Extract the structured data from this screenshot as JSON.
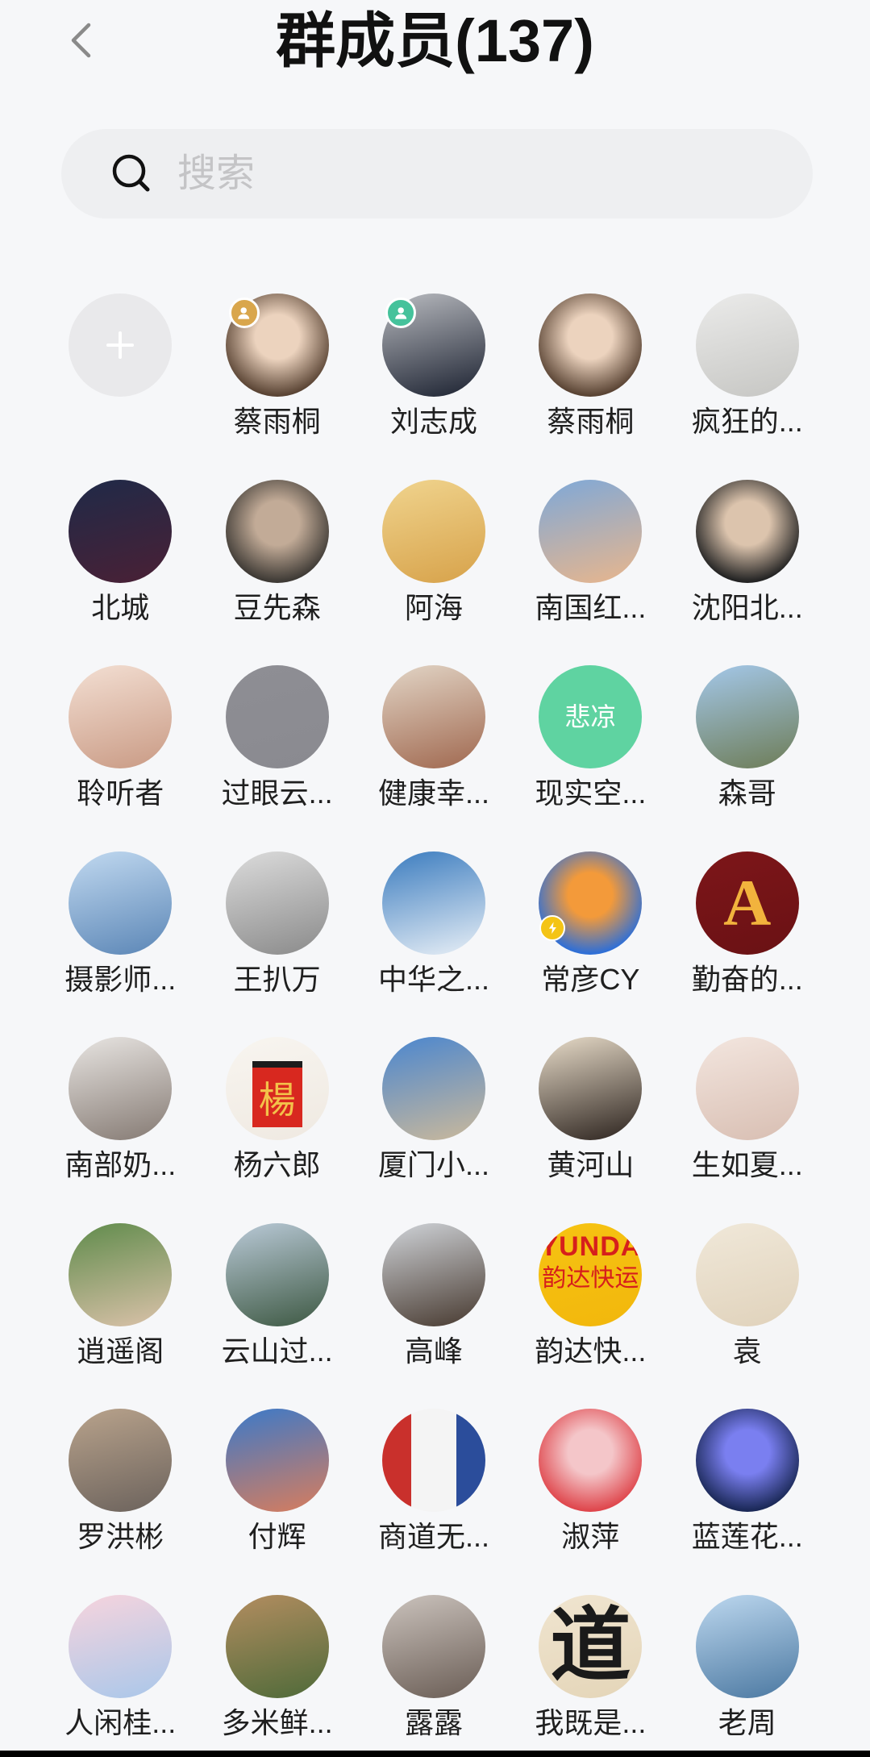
{
  "header": {
    "title": "群成员(137)",
    "back_icon": "chevron-left-icon"
  },
  "search": {
    "icon": "search-icon",
    "placeholder": "搜索"
  },
  "add_member": {
    "icon": "plus-icon"
  },
  "members": [
    {
      "name": "蔡雨桐",
      "colors": [
        "#ecd3be",
        "#5a4434"
      ],
      "badge": "owner-badge-icon"
    },
    {
      "name": "刘志成",
      "colors": [
        "#b9bbc0",
        "#1b2130"
      ],
      "badge": "admin-badge-icon"
    },
    {
      "name": "蔡雨桐",
      "colors": [
        "#ecd3be",
        "#5a4434"
      ]
    },
    {
      "name": "疯狂的...",
      "colors": [
        "#ebebea",
        "#c6c6c3"
      ]
    },
    {
      "name": "北城",
      "colors": [
        "#1f2a48",
        "#4a2035"
      ]
    },
    {
      "name": "豆先森",
      "colors": [
        "#c2ab97",
        "#3e3a35"
      ]
    },
    {
      "name": "阿海",
      "colors": [
        "#f0d48e",
        "#d7a24a"
      ]
    },
    {
      "name": "南国红...",
      "colors": [
        "#7ea8d8",
        "#e9b68c"
      ]
    },
    {
      "name": "沈阳北...",
      "colors": [
        "#dcc4ad",
        "#232323"
      ]
    },
    {
      "name": "聆听者",
      "colors": [
        "#f3dfd3",
        "#c99a84"
      ]
    },
    {
      "name": "过眼云...",
      "colors": [
        "#8e8e94",
        "#8a8a90"
      ]
    },
    {
      "name": "健康幸...",
      "colors": [
        "#e2d5c6",
        "#a0684f"
      ]
    },
    {
      "name": "现实空...",
      "colors": [
        "#5fd3a1",
        "#5fd3a1"
      ],
      "avatar_text": [
        "悲凉"
      ]
    },
    {
      "name": "森哥",
      "colors": [
        "#a4c8ea",
        "#6d7c56"
      ]
    },
    {
      "name": "摄影师...",
      "colors": [
        "#c1d9f0",
        "#5b86b6"
      ]
    },
    {
      "name": "王扒万",
      "colors": [
        "#dcdcdc",
        "#8a8a8a"
      ]
    },
    {
      "name": "中华之...",
      "colors": [
        "#3b7cbf",
        "#e8eff6"
      ]
    },
    {
      "name": "常彦CY",
      "colors": [
        "#f39a3a",
        "#2f6fd6"
      ],
      "badge": "vip-badge-icon"
    },
    {
      "name": "勤奋的...",
      "colors": [
        "#7d1619",
        "#6a1114"
      ],
      "avatar_text": [
        "A"
      ]
    },
    {
      "name": "南部奶...",
      "colors": [
        "#e8e5e2",
        "#857a73"
      ]
    },
    {
      "name": "杨六郎",
      "colors": [
        "#f8f5f0",
        "#efe9e1"
      ],
      "avatar_text": [
        "楊"
      ]
    },
    {
      "name": "厦门小...",
      "colors": [
        "#4a86cf",
        "#cbb99b"
      ]
    },
    {
      "name": "黄河山",
      "colors": [
        "#e8dcc9",
        "#2b221d"
      ]
    },
    {
      "name": "生如夏...",
      "colors": [
        "#f3e6df",
        "#d8beb2"
      ]
    },
    {
      "name": "逍遥阁",
      "colors": [
        "#5f8b4b",
        "#dbc2aa"
      ]
    },
    {
      "name": "云山过...",
      "colors": [
        "#bacad8",
        "#3d5842"
      ]
    },
    {
      "name": "高峰",
      "colors": [
        "#d0d4d9",
        "#47392f"
      ]
    },
    {
      "name": "韵达快...",
      "colors": [
        "#f6c312",
        "#f2b70c"
      ],
      "avatar_text": [
        "YUNDA",
        "韵达快运"
      ]
    },
    {
      "name": "袁",
      "colors": [
        "#f0e8d9",
        "#e0d2bb"
      ]
    },
    {
      "name": "罗洪彬",
      "colors": [
        "#b9a38c",
        "#6b625c"
      ]
    },
    {
      "name": "付辉",
      "colors": [
        "#3b79c9",
        "#d97d5c"
      ]
    },
    {
      "name": "商道无...",
      "colors": [
        "#c9302c",
        "#f4f4f4",
        "#2b4d9b"
      ]
    },
    {
      "name": "淑萍",
      "colors": [
        "#f4c6c9",
        "#df474d"
      ]
    },
    {
      "name": "蓝莲花...",
      "colors": [
        "#7a7ff0",
        "#1b2958"
      ]
    },
    {
      "name": "人闲桂...",
      "colors": [
        "#f7d4dd",
        "#a9c7ea"
      ]
    },
    {
      "name": "多米鲜...",
      "colors": [
        "#b38d60",
        "#4e6a39"
      ]
    },
    {
      "name": "露露",
      "colors": [
        "#cbc3bd",
        "#6a5d55"
      ]
    },
    {
      "name": "我既是...",
      "colors": [
        "#f0e5d0",
        "#e4d5b8"
      ],
      "avatar_text": [
        "道"
      ]
    },
    {
      "name": "老周",
      "colors": [
        "#bdd8ef",
        "#4b78a1"
      ]
    }
  ],
  "colors": {
    "page_background": "#f6f7f9",
    "search_background": "#eeeff1",
    "placeholder": "#c4c4c6",
    "title": "#111111",
    "owner_badge": "#d9a64c",
    "admin_badge": "#45c29b",
    "vip_badge": "#f4c415"
  }
}
